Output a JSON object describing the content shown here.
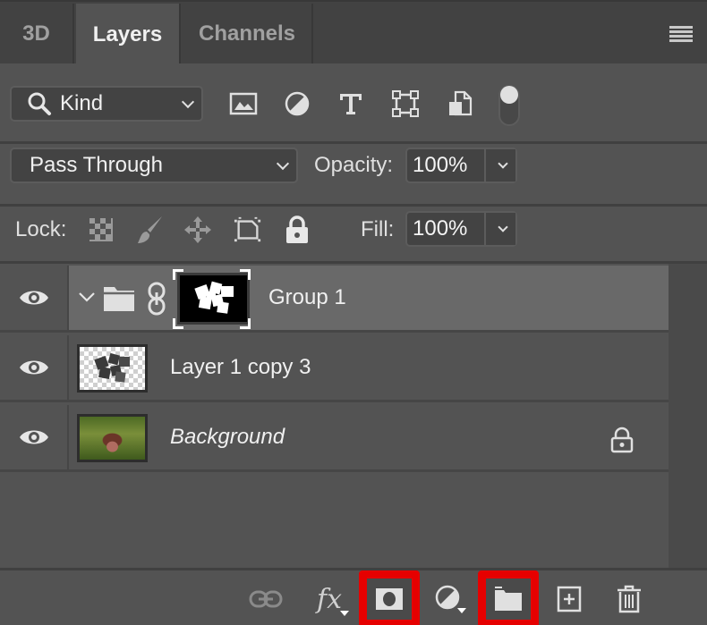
{
  "tabs": [
    {
      "label": "3D",
      "active": false
    },
    {
      "label": "Layers",
      "active": true
    },
    {
      "label": "Channels",
      "active": false
    }
  ],
  "panel_menu_icon": "hamburger-menu-icon",
  "filter": {
    "kind_label": "Kind",
    "icons": [
      "image-filter-icon",
      "adjustment-filter-icon",
      "type-filter-icon",
      "shape-filter-icon",
      "smart-object-filter-icon",
      "filter-toggle-icon"
    ]
  },
  "blend": {
    "mode": "Pass Through",
    "opacity_label": "Opacity:",
    "opacity_value": "100%"
  },
  "lock": {
    "label": "Lock:",
    "icons": [
      "lock-transparent-pixels-icon",
      "lock-image-pixels-icon",
      "lock-position-icon",
      "lock-artboard-icon",
      "lock-all-icon"
    ],
    "fill_label": "Fill:",
    "fill_value": "100%"
  },
  "layers": [
    {
      "name": "Group 1",
      "type": "group",
      "visible": true,
      "selected": true,
      "expanded": false,
      "has_mask": true,
      "linked": true
    },
    {
      "name": "Layer 1 copy 3",
      "type": "pixel",
      "visible": true,
      "selected": false
    },
    {
      "name": "Background",
      "type": "background",
      "visible": true,
      "selected": false,
      "locked": true
    }
  ],
  "footer": {
    "buttons": [
      {
        "name": "link-layers-button",
        "icon": "link-icon",
        "highlighted": false
      },
      {
        "name": "add-layer-style-button",
        "icon": "fx-icon",
        "label": "fx",
        "highlighted": false
      },
      {
        "name": "add-layer-mask-button",
        "icon": "mask-icon",
        "highlighted": true
      },
      {
        "name": "new-adjustment-layer-button",
        "icon": "adjustment-icon",
        "highlighted": false
      },
      {
        "name": "new-group-button",
        "icon": "folder-icon",
        "highlighted": true
      },
      {
        "name": "new-layer-button",
        "icon": "new-layer-icon",
        "highlighted": false
      },
      {
        "name": "delete-layer-button",
        "icon": "trash-icon",
        "highlighted": false
      }
    ]
  },
  "colors": {
    "panel_bg": "#535353",
    "tabbar_bg": "#424242",
    "selected_row": "#696969",
    "highlight_red": "#e60000"
  }
}
